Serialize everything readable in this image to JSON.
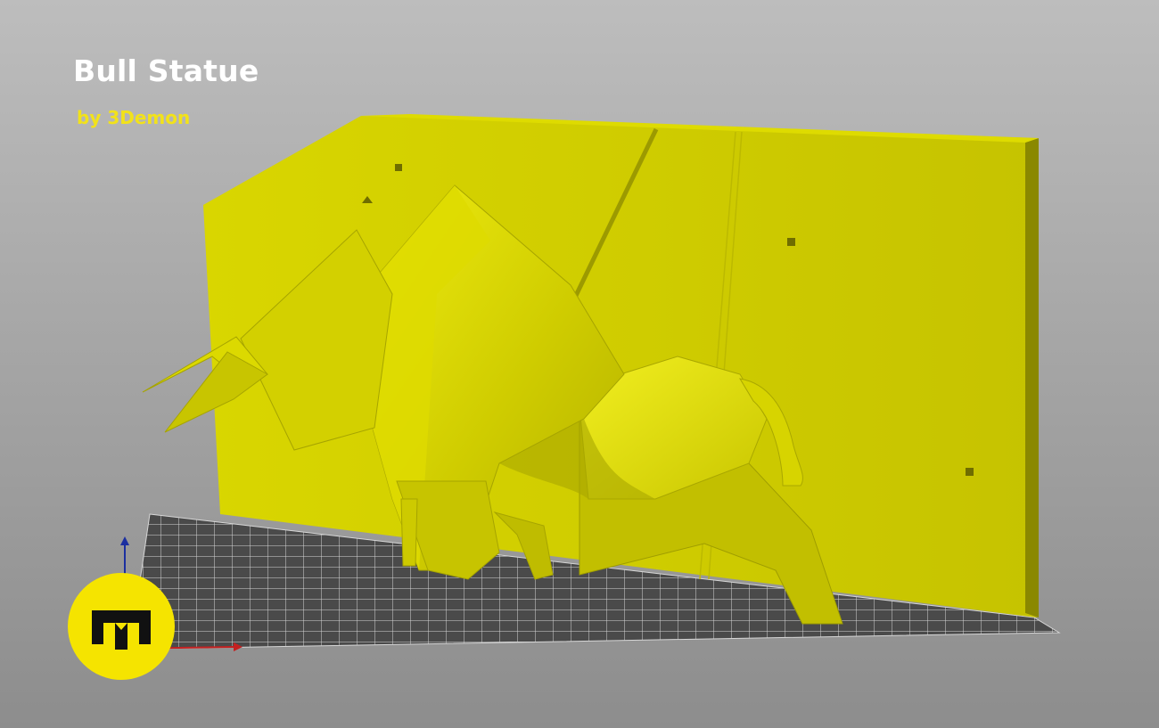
{
  "header": {
    "title": "Bull Statue",
    "author": "by 3Demon"
  },
  "colors": {
    "model_light": "#e6e300",
    "model_mid": "#cfcc00",
    "model_dark": "#a9a700",
    "model_shadow": "#7f7d00",
    "bed_fill": "#4a4a4a",
    "bed_grid": "#dcdcdc",
    "axis_x": "#c42020",
    "axis_z": "#1b2fa0",
    "logo_bg": "#f5e400",
    "logo_mark": "#111111"
  },
  "icons": {
    "logo": "3demon-logo-icon",
    "axis_x": "x-axis-arrow-icon",
    "axis_z": "z-axis-arrow-icon"
  }
}
